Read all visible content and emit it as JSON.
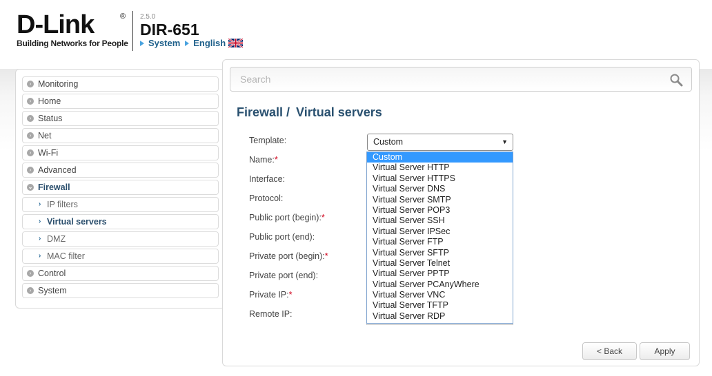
{
  "header": {
    "brand": "D-Link",
    "brand_mark": "®",
    "tagline": "Building Networks for People",
    "firmware_version": "2.5.0",
    "model": "DIR-651",
    "links": [
      {
        "label": "System",
        "icon": "triangle-right-icon"
      },
      {
        "label": "English",
        "icon": "triangle-right-icon"
      }
    ],
    "language_flag": "uk-flag-icon"
  },
  "sidebar": {
    "items": [
      {
        "label": "Monitoring"
      },
      {
        "label": "Home"
      },
      {
        "label": "Status"
      },
      {
        "label": "Net"
      },
      {
        "label": "Wi-Fi"
      },
      {
        "label": "Advanced"
      },
      {
        "label": "Firewall",
        "expanded": true
      },
      {
        "label": "Control"
      },
      {
        "label": "System"
      }
    ],
    "firewall_children": [
      {
        "label": "IP filters"
      },
      {
        "label": "Virtual servers",
        "active": true
      },
      {
        "label": "DMZ"
      },
      {
        "label": "MAC filter"
      }
    ]
  },
  "search": {
    "placeholder": "Search"
  },
  "page": {
    "breadcrumb_parent": "Firewall /",
    "title": "Virtual servers"
  },
  "form": {
    "template_label": "Template:",
    "fields": [
      {
        "label": "Name:",
        "required": true
      },
      {
        "label": "Interface:",
        "required": false
      },
      {
        "label": "Protocol:",
        "required": false
      },
      {
        "label": "Public port (begin):",
        "required": true
      },
      {
        "label": "Public port (end):",
        "required": false
      },
      {
        "label": "Private port (begin):",
        "required": true
      },
      {
        "label": "Private port (end):",
        "required": false
      },
      {
        "label": "Private IP:",
        "required": true
      },
      {
        "label": "Remote IP:",
        "required": false
      }
    ],
    "required_mark": "*",
    "template_selected": "Custom",
    "template_options": [
      "Custom",
      "Virtual Server HTTP",
      "Virtual Server HTTPS",
      "Virtual Server DNS",
      "Virtual Server SMTP",
      "Virtual Server POP3",
      "Virtual Server SSH",
      "Virtual Server IPSec",
      "Virtual Server FTP",
      "Virtual Server SFTP",
      "Virtual Server Telnet",
      "Virtual Server PPTP",
      "Virtual Server PCAnyWhere",
      "Virtual Server VNC",
      "Virtual Server TFTP",
      "Virtual Server RDP"
    ]
  },
  "buttons": {
    "back": "< Back",
    "apply": "Apply"
  },
  "colors": {
    "accent_text": "#29506f",
    "link": "#1d5f8a",
    "highlight": "#3399ff"
  }
}
